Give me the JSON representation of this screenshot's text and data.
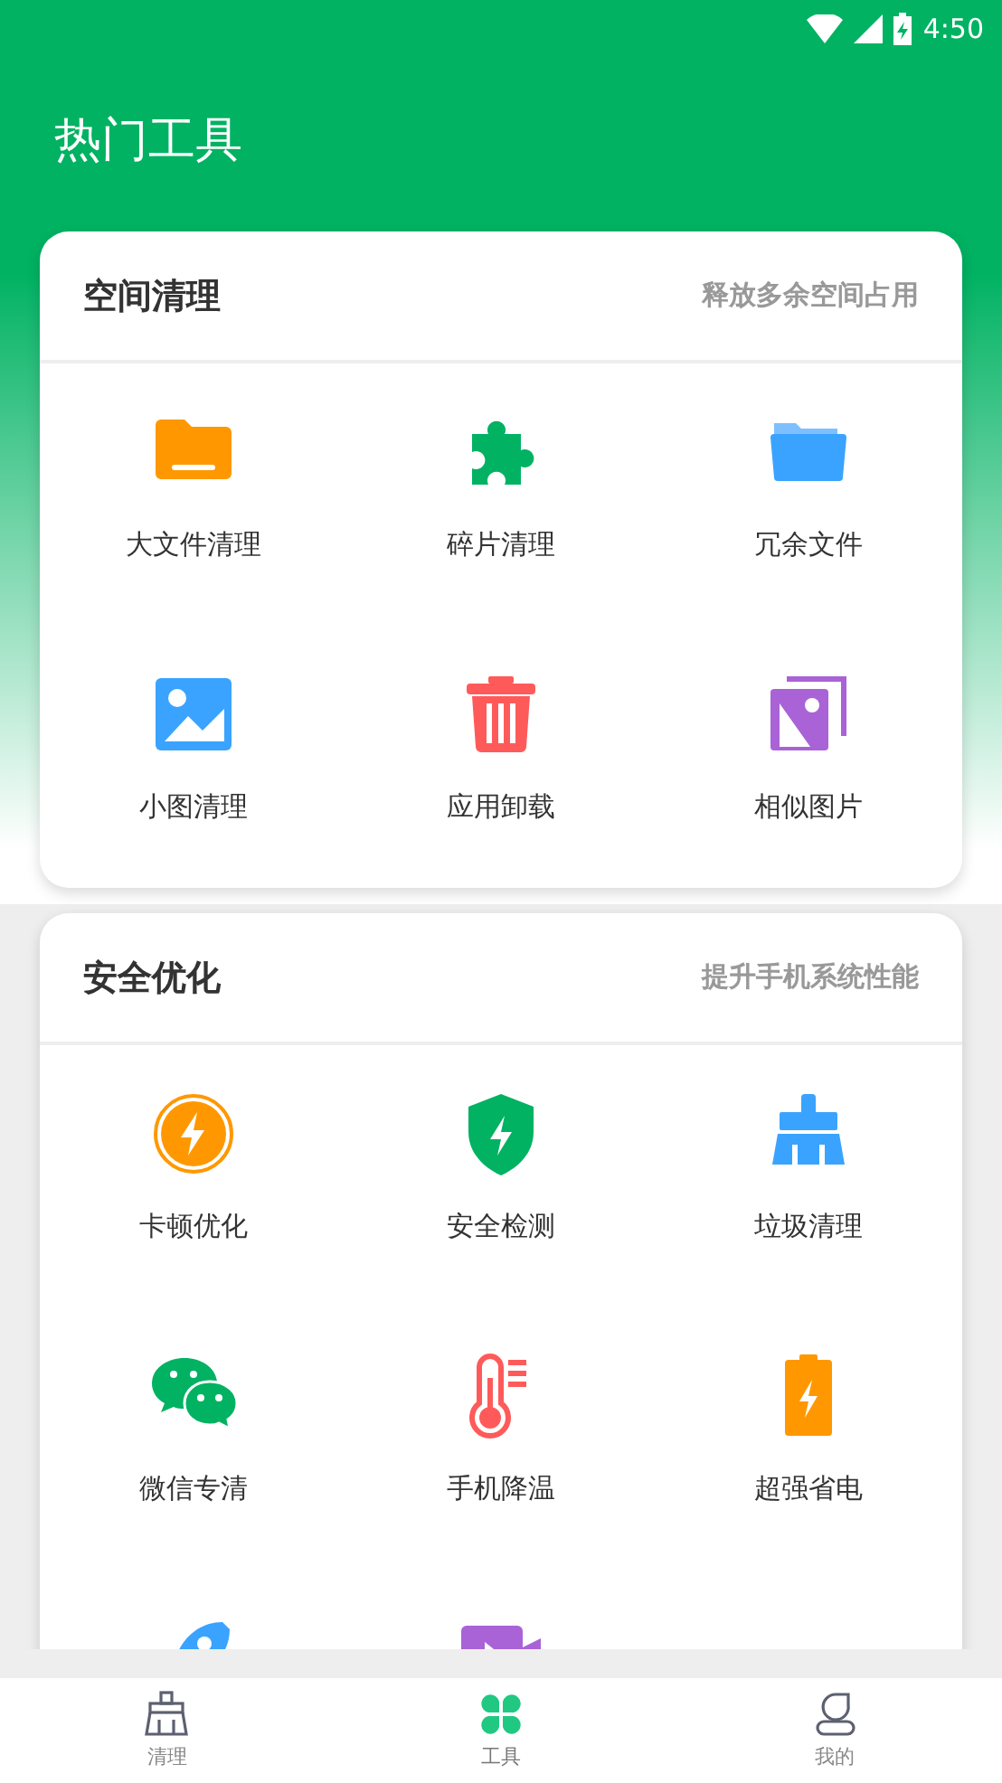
{
  "status_bar": {
    "time": "4:50"
  },
  "header": {
    "title": "热门工具"
  },
  "sections": [
    {
      "title": "空间清理",
      "subtitle": "释放多余空间占用",
      "items": [
        {
          "label": "大文件清理"
        },
        {
          "label": "碎片清理"
        },
        {
          "label": "冗余文件"
        },
        {
          "label": "小图清理"
        },
        {
          "label": "应用卸载"
        },
        {
          "label": "相似图片"
        }
      ]
    },
    {
      "title": "安全优化",
      "subtitle": "提升手机系统性能",
      "items": [
        {
          "label": "卡顿优化"
        },
        {
          "label": "安全检测"
        },
        {
          "label": "垃圾清理"
        },
        {
          "label": "微信专清"
        },
        {
          "label": "手机降温"
        },
        {
          "label": "超强省电"
        },
        {
          "partial": true
        },
        {
          "partial": true
        }
      ]
    }
  ],
  "bottom_nav": [
    {
      "label": "清理",
      "selected": false
    },
    {
      "label": "工具",
      "selected": true
    },
    {
      "label": "我的",
      "selected": false
    }
  ]
}
